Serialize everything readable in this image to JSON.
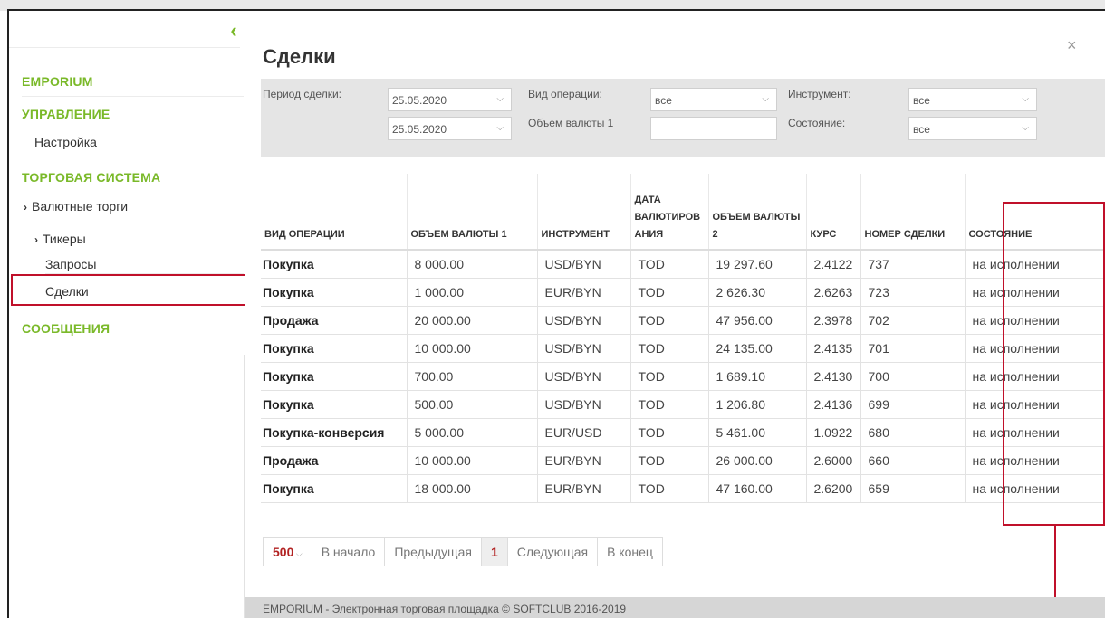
{
  "sidebar": {
    "collapse_icon": "chevron-left-icon",
    "sections": {
      "emporium": "EMPORIUM",
      "management": "УПРАВЛЕНИЕ",
      "settings": "Настройка",
      "trading_system": "ТОРГОВАЯ СИСТЕМА",
      "fx_trading": "Валютные торги",
      "tickers": "Тикеры",
      "requests": "Запросы",
      "deals": "Сделки",
      "messages": "СООБЩЕНИЯ"
    }
  },
  "page": {
    "title": "Сделки",
    "close_symbol": "×"
  },
  "filters": {
    "period_label": "Период сделки:",
    "period_from": "25.05.2020",
    "period_to": "25.05.2020",
    "op_type_label": "Вид операции:",
    "op_type_value": "все",
    "amount_label": "Объем валюты 1",
    "amount_value": "",
    "instrument_label": "Инструмент:",
    "instrument_value": "все",
    "state_label": "Состояние:",
    "state_value": "все"
  },
  "table": {
    "headers": {
      "op": "ВИД ОПЕРАЦИИ",
      "amount1": "ОБЪЕМ ВАЛЮТЫ 1",
      "instrument": "ИНСТРУМЕНТ",
      "date_a": "ДАТА",
      "date_b": "ВАЛЮТИРОВ",
      "date_c": "АНИЯ",
      "amount2_a": "ОБЪЕМ ВАЛЮТЫ",
      "amount2_b": "2",
      "rate": "КУРС",
      "deal_no": "НОМЕР СДЕЛКИ",
      "state": "СОСТОЯНИЕ"
    },
    "rows": [
      {
        "op": "Покупка",
        "amount1": "8 000.00",
        "instrument": "USD/BYN",
        "date": "TOD",
        "amount2": "19 297.60",
        "rate": "2.4122",
        "deal_no": "737",
        "state": "на исполнении"
      },
      {
        "op": "Покупка",
        "amount1": "1 000.00",
        "instrument": "EUR/BYN",
        "date": "TOD",
        "amount2": "2 626.30",
        "rate": "2.6263",
        "deal_no": "723",
        "state": "на исполнении"
      },
      {
        "op": "Продажа",
        "amount1": "20 000.00",
        "instrument": "USD/BYN",
        "date": "TOD",
        "amount2": "47 956.00",
        "rate": "2.3978",
        "deal_no": "702",
        "state": "на исполнении"
      },
      {
        "op": "Покупка",
        "amount1": "10 000.00",
        "instrument": "USD/BYN",
        "date": "TOD",
        "amount2": "24 135.00",
        "rate": "2.4135",
        "deal_no": "701",
        "state": "на исполнении"
      },
      {
        "op": "Покупка",
        "amount1": "700.00",
        "instrument": "USD/BYN",
        "date": "TOD",
        "amount2": "1 689.10",
        "rate": "2.4130",
        "deal_no": "700",
        "state": "на исполнении"
      },
      {
        "op": "Покупка",
        "amount1": "500.00",
        "instrument": "USD/BYN",
        "date": "TOD",
        "amount2": "1 206.80",
        "rate": "2.4136",
        "deal_no": "699",
        "state": "на исполнении"
      },
      {
        "op": "Покупка-конверсия",
        "amount1": "5 000.00",
        "instrument": "EUR/USD",
        "date": "TOD",
        "amount2": "5 461.00",
        "rate": "1.0922",
        "deal_no": "680",
        "state": "на исполнении"
      },
      {
        "op": "Продажа",
        "amount1": "10 000.00",
        "instrument": "EUR/BYN",
        "date": "TOD",
        "amount2": "26 000.00",
        "rate": "2.6000",
        "deal_no": "660",
        "state": "на исполнении"
      },
      {
        "op": "Покупка",
        "amount1": "18 000.00",
        "instrument": "EUR/BYN",
        "date": "TOD",
        "amount2": "47 160.00",
        "rate": "2.6200",
        "deal_no": "659",
        "state": "на исполнении"
      }
    ]
  },
  "pager": {
    "page_size": "500",
    "first": "В начало",
    "prev": "Предыдущая",
    "current": "1",
    "next": "Следующая",
    "last": "В конец"
  },
  "footer": {
    "text": "EMPORIUM - Электронная торговая площадка © SOFTCLUB 2016-2019"
  },
  "colors": {
    "accent": "#7ab929",
    "highlight": "#c0102a",
    "filter_bg": "#e5e5e5"
  }
}
